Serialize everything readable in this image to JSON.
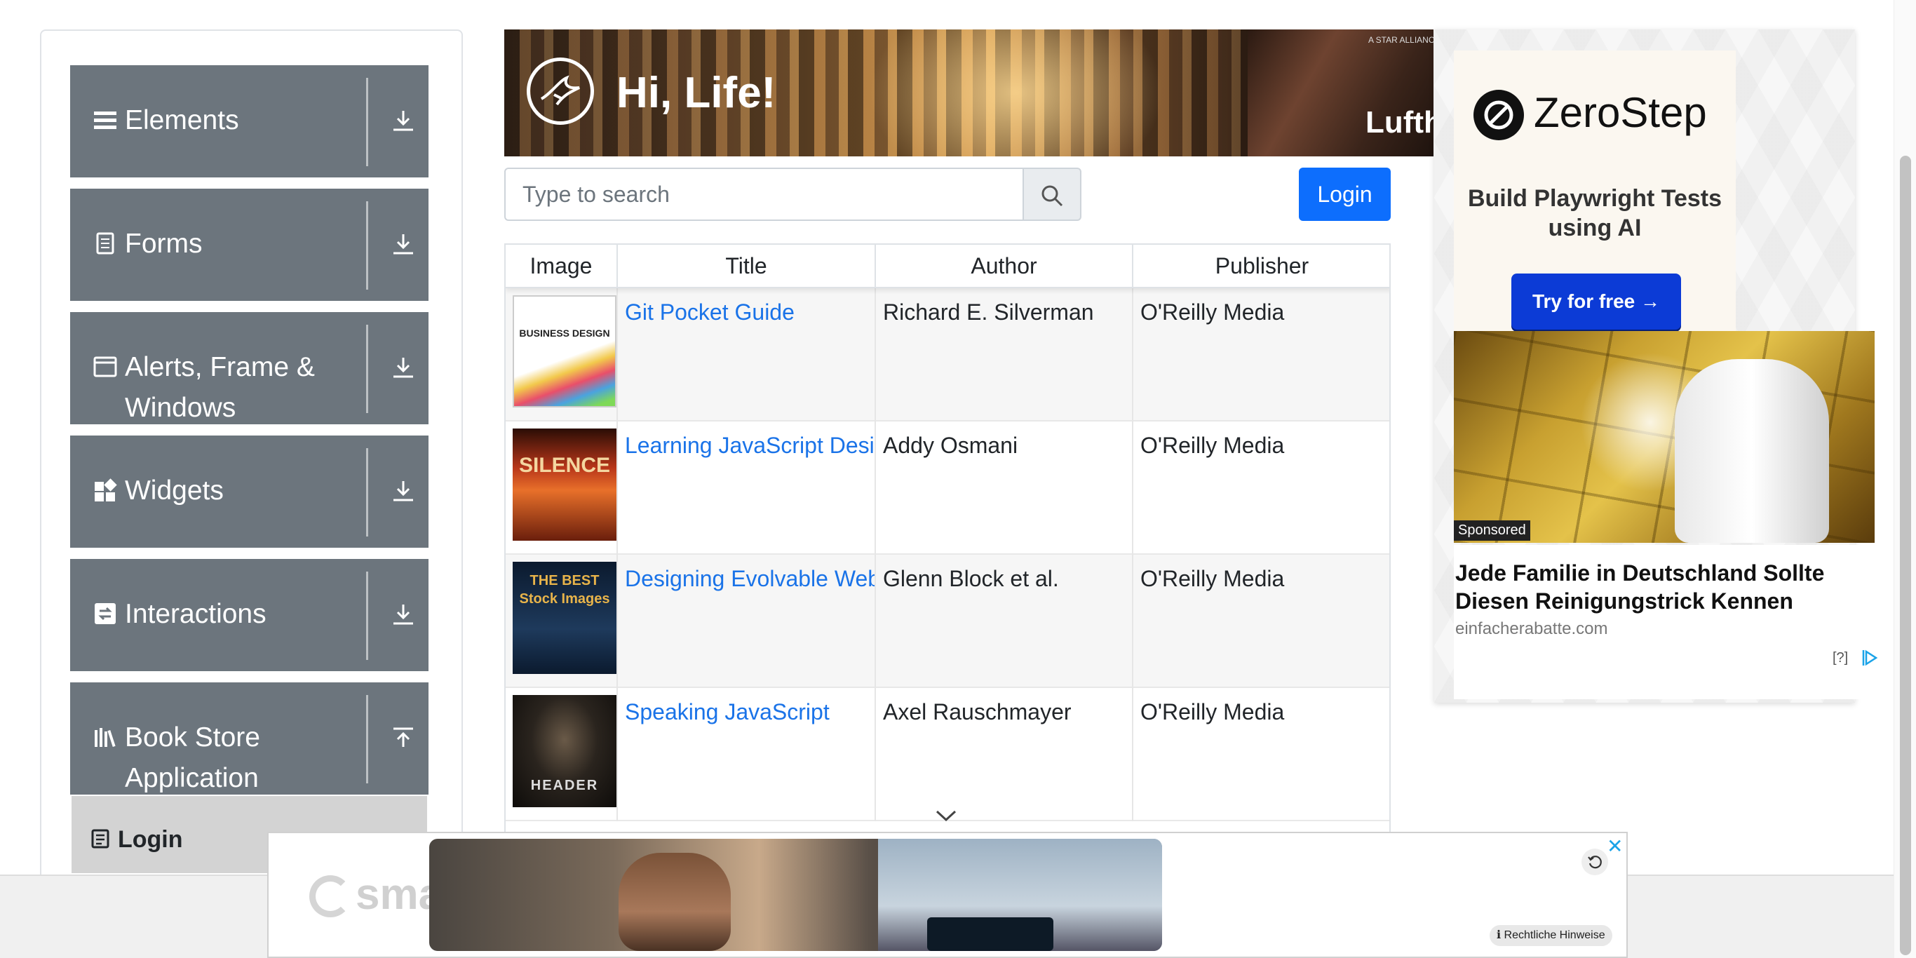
{
  "nav": {
    "groups": [
      {
        "label": "Elements",
        "icon": "hamburger-icon",
        "arrow": "download-icon"
      },
      {
        "label": "Forms",
        "icon": "document-icon",
        "arrow": "download-icon"
      },
      {
        "label": "Alerts, Frame & Windows",
        "icon": "window-icon",
        "arrow": "download-icon"
      },
      {
        "label": "Widgets",
        "icon": "widgets-icon",
        "arrow": "download-icon"
      },
      {
        "label": "Interactions",
        "icon": "interactions-icon",
        "arrow": "download-icon"
      },
      {
        "label": "Book Store Application",
        "icon": "books-icon",
        "arrow": "upload-icon"
      }
    ],
    "active_item": {
      "label": "Login",
      "icon": "login-list-icon"
    }
  },
  "banner": {
    "greeting": "Hi, Life!",
    "brand": "Lufth",
    "small_text": "A STAR ALLIANCE"
  },
  "search": {
    "placeholder": "Type to search",
    "icon": "search-icon"
  },
  "login_button": "Login",
  "table": {
    "headers": [
      "Image",
      "Title",
      "Author",
      "Publisher"
    ],
    "rows": [
      {
        "cover": "BUSINESS DESIGN",
        "title": "Git Pocket Guide",
        "author": "Richard E. Silverman",
        "publisher": "O'Reilly Media"
      },
      {
        "cover": "SILENCE",
        "title": "Learning JavaScript Design Patterns",
        "author": "Addy Osmani",
        "publisher": "O'Reilly Media"
      },
      {
        "cover": "THE BEST Stock Images",
        "title": "Designing Evolvable Web APIs with ASP.NET",
        "author": "Glenn Block et al.",
        "publisher": "O'Reilly Media"
      },
      {
        "cover": "HEADER",
        "title": "Speaking JavaScript",
        "author": "Axel Rauschmayer",
        "publisher": "O'Reilly Media"
      }
    ]
  },
  "right_ad": {
    "brand": "ZeroStep",
    "tagline": "Build Playwright Tests using AI",
    "cta": "Try for free →",
    "sponsored": "Sponsored",
    "promo_title": "Jede Familie in Deutschland Sollte Diesen Reinigungstrick Kennen",
    "promo_domain": "einfacherabatte.com",
    "adchoice": "[?]"
  },
  "bottom_ad": {
    "brand": "smart",
    "legal": "Rechtliche Hinweise",
    "close": "✕",
    "info_icon": "info-icon",
    "replay_icon": "replay-icon"
  },
  "colors": {
    "nav_bg": "#6c757d",
    "primary": "#0d6efd",
    "link": "#1a73e8",
    "ad_button": "#0c3bd6"
  }
}
